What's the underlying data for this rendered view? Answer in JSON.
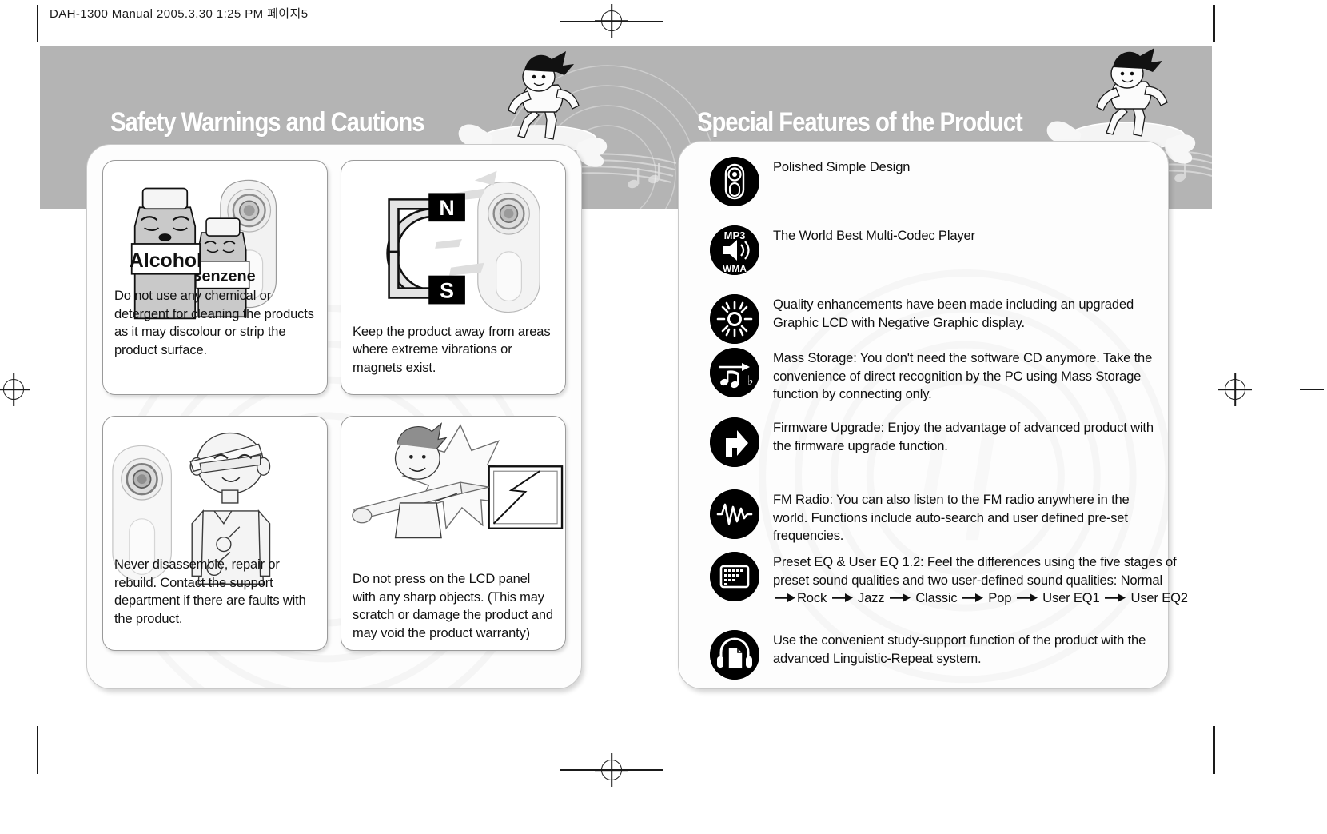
{
  "page": {
    "header_line": "DAH-1300 Manual  2005.3.30 1:25 PM  페이지5"
  },
  "sections": {
    "left": {
      "title": "Safety Warnings and Cautions",
      "cards": [
        {
          "id": "chemical-detergent",
          "art": "alcohol-benzene-bottles",
          "labels": [
            "Alcohol",
            "Benzene"
          ],
          "text": "Do not use any chemical or detergent for cleaning the products as it may discolour or strip the product surface."
        },
        {
          "id": "magnets-vibration",
          "art": "horseshoe-magnet",
          "labels": [
            "N",
            "S"
          ],
          "text": "Keep the product away from areas where extreme vibrations or magnets exist."
        },
        {
          "id": "no-disassembly",
          "art": "repairman-character",
          "labels": [],
          "text": "Never disassemble, repair or rebuild. Contact the support department if there are faults with the product."
        },
        {
          "id": "lcd-panel-care",
          "art": "broken-lcd-panel",
          "labels": [],
          "text": "Do not press on the LCD panel with any sharp objects. (This may scratch or damage  the product and may void the product warranty)"
        }
      ]
    },
    "right": {
      "title": "Special Features of the Product",
      "features": [
        {
          "icon": "player-body-icon",
          "text": "Polished Simple Design"
        },
        {
          "icon": "mp3-wma-speaker-icon",
          "icon_labels": [
            "MP3",
            "WMA"
          ],
          "text": "The World Best Multi-Codec Player"
        },
        {
          "icon": "brightness-sun-icon",
          "text": "Quality enhancements have  been made including an upgraded Graphic LCD with Negative Graphic display."
        },
        {
          "icon": "music-notes-transfer-icon",
          "text": "Mass Storage: You don't need the software CD anymore. Take the convenience of direct recognition by the PC using Mass Storage function by connecting only."
        },
        {
          "icon": "firmware-upgrade-arrow-icon",
          "text": "Firmware Upgrade: Enjoy the advantage of advanced product with the firmware upgrade function."
        },
        {
          "icon": "fm-radio-wave-icon",
          "text": "FM Radio: You can also listen to the FM radio anywhere in the world. Functions include auto-search and user defined pre-set frequencies."
        },
        {
          "icon": "equalizer-grid-icon",
          "text": "Preset EQ & User EQ 1.2: Feel the differences using the five stages of preset sound qualities and two user-defined sound qualities: Normal",
          "eq_chain": [
            "Rock",
            "Jazz",
            "Classic",
            "Pop",
            "User EQ1",
            "User EQ2"
          ]
        },
        {
          "icon": "headphone-document-icon",
          "text": "Use the convenient study-support function of the product with the advanced Linguistic-Repeat system."
        }
      ]
    }
  },
  "colors": {
    "banner_grey": "#b4b4b4",
    "icon_black": "#000000",
    "title_white": "#ffffff",
    "body_text": "#0f0f0f",
    "card_border": "#9a9a9a"
  }
}
